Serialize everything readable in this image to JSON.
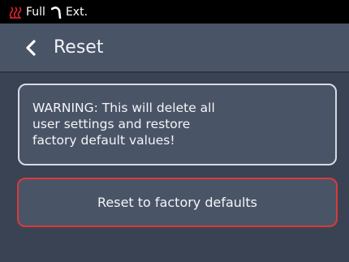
{
  "status_bar": {
    "heat_icon": "heater-icon",
    "mode_label": "Full",
    "hose_icon": "hose-icon",
    "ext_label": "Ext."
  },
  "header": {
    "back_icon": "chevron-left-icon",
    "title": "Reset"
  },
  "warning": {
    "text": "WARNING: This will delete all\nuser settings and restore\nfactory default values!"
  },
  "reset_button": {
    "label": "Reset to factory defaults"
  },
  "colors": {
    "background": "#3a4354",
    "panel": "#4a5467",
    "status_bar": "#000000",
    "heat_icon": "#e0262b",
    "danger_border": "#d93a3a",
    "box_border": "#d8dbe0"
  }
}
